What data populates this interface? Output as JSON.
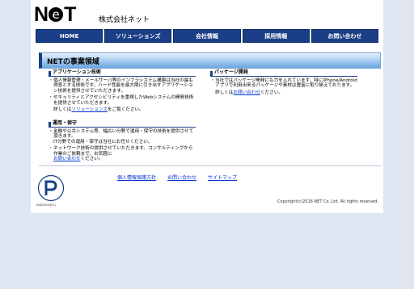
{
  "header": {
    "logo_text": "NET",
    "company_name": "株式会社ネット"
  },
  "nav": {
    "items": [
      {
        "label": "HOME"
      },
      {
        "label": "ソリューションズ"
      },
      {
        "label": "会社情報"
      },
      {
        "label": "採用情報"
      },
      {
        "label": "お問い合わせ"
      }
    ]
  },
  "main": {
    "title": "NETの事業領域",
    "application": {
      "heading": "アプリケーション技術",
      "bullet1": "個人情報管理・メールサーバ等のインフラシステム構築は当社の最も得意とする技術です。ハード性能を最大限に引き出すアプリケーション技術を提供させていただきます。",
      "bullet2": "セキュリティとアクセシビリティを重視したWebシステムの開発技術を提供させていただきます。",
      "detail_prefix": "詳しくは",
      "detail_link": "ソリューションズ",
      "detail_suffix": "をご覧ください。"
    },
    "operation": {
      "heading": "運用・保守",
      "bullet1": "金融や公共システム等、幅広い分野で運用・保守の技術を提供させて頂きます。",
      "bullet1b": "IT分野での運用・保守は当社にお任せください。",
      "bullet2": "ネットワーク技術の提供させていただきます。コンサルティングから作業のご依頼まで、お気軽に",
      "link": "お問い合わせ",
      "link_suffix": "ください。"
    },
    "package": {
      "heading": "パッケージ開発",
      "bullet1": "当社ではパッケージ開発にも力を入れています。特にiPhone/Androidアプリで利用出来るパッケージや素材は豊富に取り揃えております。",
      "detail_prefix": "詳しくは",
      "detail_link": "お問い合わせ",
      "detail_suffix": "ください。"
    }
  },
  "footer": {
    "privacy_link": "個人情報保護方針",
    "contact_link": "お問い合わせ",
    "sitemap_link": "サイトマップ",
    "copyright": "Copyright(c)2016 NET Co.,Ltd. All rights reserved.",
    "badge_number": "10820000(01)"
  }
}
